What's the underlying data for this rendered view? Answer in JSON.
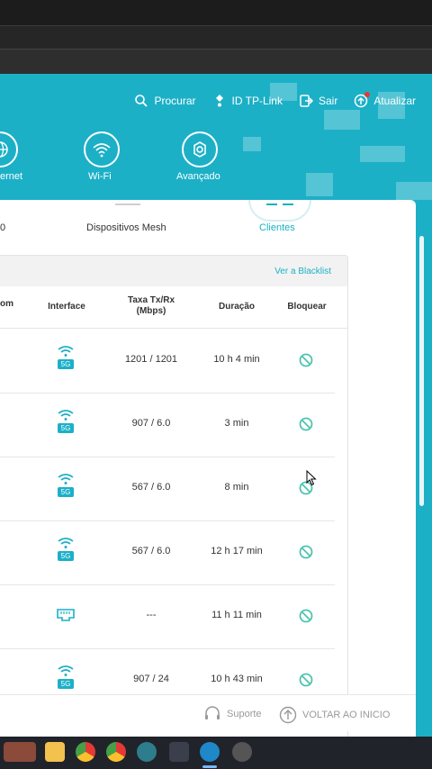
{
  "header": {
    "links": [
      {
        "label": "Procurar",
        "icon": "search-icon"
      },
      {
        "label": "ID TP-Link",
        "icon": "account-pin-icon"
      },
      {
        "label": "Sair",
        "icon": "logout-icon"
      },
      {
        "label": "Atualizar",
        "icon": "update-icon"
      }
    ],
    "nav": [
      {
        "label": "ernet",
        "icon": "globe-icon"
      },
      {
        "label": "Wi-Fi",
        "icon": "wifi-icon"
      },
      {
        "label": "Avançado",
        "icon": "gear-icon"
      }
    ]
  },
  "tabs": {
    "partial": "0",
    "mesh": "Dispositivos Mesh",
    "clients": "Clientes"
  },
  "table": {
    "blacklist_link": "Ver a Blacklist",
    "headers": {
      "partial": "om",
      "interface": "Interface",
      "rate": "Taxa Tx/Rx\n(Mbps)",
      "duration": "Duração",
      "block": "Bloquear"
    },
    "rows": [
      {
        "interface": "5G",
        "rate": "1201 / 1201",
        "duration": "10 h 4 min"
      },
      {
        "interface": "5G",
        "rate": "907 / 6.0",
        "duration": "3 min"
      },
      {
        "interface": "5G",
        "rate": "567 / 6.0",
        "duration": "8 min"
      },
      {
        "interface": "5G",
        "rate": "567 / 6.0",
        "duration": "12 h 17 min"
      },
      {
        "interface": "ethernet",
        "rate": "---",
        "duration": "11 h 11 min"
      },
      {
        "interface": "5G",
        "rate": "907 / 24",
        "duration": "10 h 43 min"
      }
    ]
  },
  "footer": {
    "support": "Suporte",
    "back": "VOLTAR AO INICIO"
  },
  "colors": {
    "accent": "#1cb0c7",
    "block_icon": "#4fc3b0"
  }
}
